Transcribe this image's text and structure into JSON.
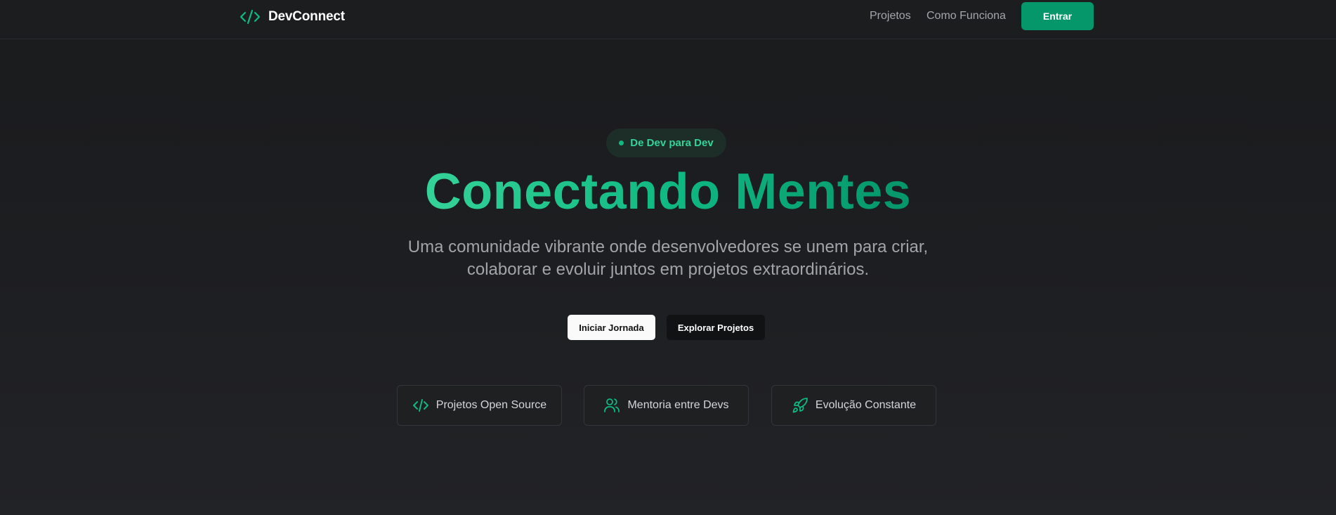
{
  "header": {
    "logo_text": "DevConnect",
    "logo_icon": "code-icon",
    "nav": {
      "projetos": "Projetos",
      "como_funciona": "Como Funciona"
    },
    "login_label": "Entrar"
  },
  "hero": {
    "badge": "De Dev para Dev",
    "title": "Conectando Mentes",
    "subtitle_line1": "Uma comunidade vibrante onde desenvolvedores se unem para criar,",
    "subtitle_line2": "colaborar e evoluir juntos em projetos extraordinários.",
    "primary_cta": "Iniciar Jornada",
    "secondary_cta": "Explorar Projetos"
  },
  "features": [
    {
      "label": "Projetos Open Source",
      "icon": "code-icon"
    },
    {
      "label": "Mentoria entre Devs",
      "icon": "users-icon"
    },
    {
      "label": "Evolução Constante",
      "icon": "rocket-icon"
    }
  ],
  "colors": {
    "accent": "#10b981",
    "accent_dark": "#059669",
    "accent_light": "#34d399",
    "background": "#1c1d1f"
  }
}
